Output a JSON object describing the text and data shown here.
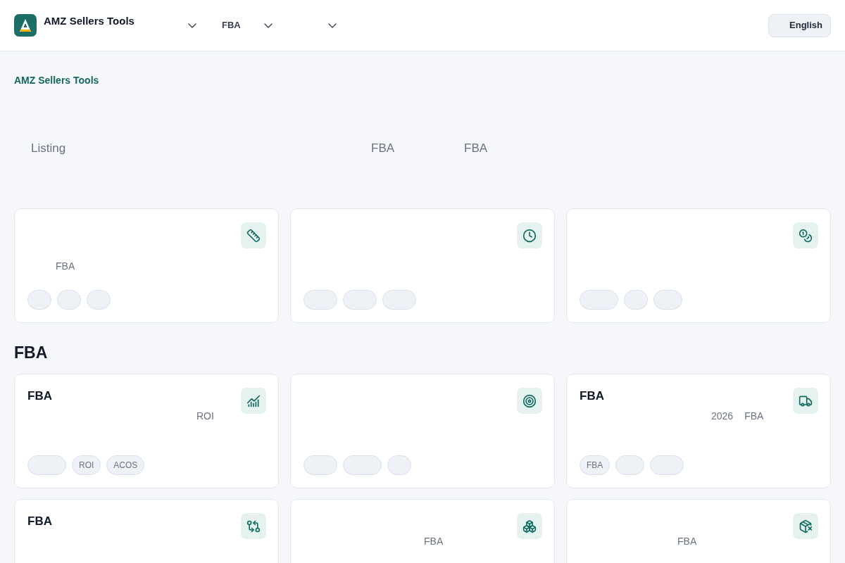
{
  "header": {
    "brand": {
      "title": "AMZ Sellers Tools"
    },
    "nav_menus": [
      {
        "expanded": false
      },
      {
        "label": "FBA",
        "expanded": false
      },
      {
        "expanded": false
      }
    ],
    "language_button": {
      "label": "English"
    }
  },
  "breadcrumb": "AMZ Sellers Tools",
  "hero": {
    "subtitle_fragments": [
      "Listing",
      "FBA",
      "FBA"
    ]
  },
  "sections": [
    {
      "cards": [
        {
          "description": [
            "FBA"
          ],
          "tags": [
            {
              "kind": "tiny"
            },
            {
              "kind": "tiny"
            },
            {
              "kind": "tiny"
            }
          ]
        },
        {
          "tags": [
            {
              "kind": "medium"
            },
            {
              "kind": "medium"
            },
            {
              "kind": "medium"
            }
          ]
        },
        {
          "tags": [
            {
              "kind": "long"
            },
            {
              "kind": "tiny"
            },
            {
              "kind": "short"
            }
          ]
        }
      ]
    },
    {
      "heading": "FBA",
      "cards": [
        {
          "title": "FBA",
          "description": [
            "ROI"
          ],
          "tags": [
            {
              "kind": "long"
            },
            {
              "kind": "text",
              "label": "ROI"
            },
            {
              "kind": "text",
              "label": "ACOS"
            }
          ]
        },
        {
          "tags": [
            {
              "kind": "medium"
            },
            {
              "kind": "long"
            },
            {
              "kind": "tiny"
            }
          ]
        },
        {
          "title": "FBA",
          "description": [
            "2026",
            "FBA"
          ],
          "tags": [
            {
              "kind": "text",
              "label": "FBA"
            },
            {
              "kind": "short"
            },
            {
              "kind": "medium"
            }
          ]
        },
        {
          "title": "FBA"
        },
        {
          "description": [
            "FBA"
          ]
        },
        {
          "description": [
            "FBA"
          ]
        }
      ]
    }
  ]
}
